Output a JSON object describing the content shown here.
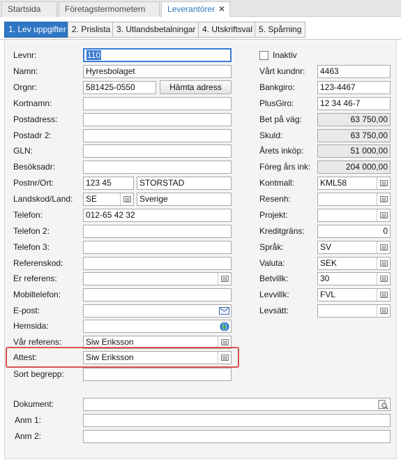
{
  "tabs": {
    "startsida": "Startsida",
    "foretag": "Företagstermometern",
    "leverantorer": "Leverantörer",
    "close": "✕"
  },
  "steps": [
    "1. Lev uppgifter",
    "2. Prislista",
    "3. Utlandsbetalningar",
    "4. Utskriftsval",
    "5. Spårning"
  ],
  "left": {
    "levnr_label": "Levnr:",
    "levnr_value": "110",
    "namn_label": "Namn:",
    "namn_value": "Hyresbolaget",
    "orgnr_label": "Orgnr:",
    "orgnr_value": "581425-0550",
    "hamta_button": "Hämta adress",
    "kortnamn_label": "Kortnamn:",
    "postadress_label": "Postadress:",
    "postadr2_label": "Postadr 2:",
    "gln_label": "GLN:",
    "besoksadr_label": "Besöksadr:",
    "postnr_label": "Postnr/Ort:",
    "postnr_value": "123 45",
    "ort_value": "STORSTAD",
    "landskod_label": "Landskod/Land:",
    "landskod_value": "SE",
    "land_value": "Sverige",
    "telefon_label": "Telefon:",
    "telefon_value": "012-65 42 32",
    "telefon2_label": "Telefon 2:",
    "telefon3_label": "Telefon 3:",
    "referenskod_label": "Referenskod:",
    "erreferens_label": "Er referens:",
    "mobil_label": "Mobiltelefon:",
    "epost_label": "E-post:",
    "hemsida_label": "Hemsida:",
    "varreferens_label": "Vår referens:",
    "varreferens_value": "Siw Eriksson",
    "attest_label": "Attest:",
    "attest_value": "Siw Eriksson",
    "sortbegrepp_label": "Sort begrepp:",
    "dokument_label": "Dokument:",
    "anm1_label": "Anm 1:",
    "anm2_label": "Anm 2:"
  },
  "right": {
    "inaktiv_label": "Inaktiv",
    "kundnr_label": "Vårt kundnr:",
    "kundnr_value": "4463",
    "bankgiro_label": "Bankgiro:",
    "bankgiro_value": "123-4467",
    "plusgiro_label": "PlusGiro:",
    "plusgiro_value": "12 34 46-7",
    "betpavag_label": "Bet på väg:",
    "betpavag_value": "63 750,00",
    "skuld_label": "Skuld:",
    "skuld_value": "63 750,00",
    "aretsinkop_label": "Årets inköp:",
    "aretsinkop_value": "51 000,00",
    "foreg_label": "Föreg års ink:",
    "foreg_value": "204 000,00",
    "kontmall_label": "Kontmall:",
    "kontmall_value": "KML58",
    "resenh_label": "Resenh:",
    "projekt_label": "Projekt:",
    "kreditgrans_label": "Kreditgräns:",
    "kreditgrans_value": "0",
    "sprak_label": "Språk:",
    "sprak_value": "SV",
    "valuta_label": "Valuta:",
    "valuta_value": "SEK",
    "betvillk_label": "Betvillk:",
    "betvillk_value": "30",
    "levvillk_label": "Levvillk:",
    "levvillk_value": "FVL",
    "levsatt_label": "Levsätt:"
  },
  "icons": {
    "lookup": "lookup-list-icon",
    "email": "envelope-icon",
    "web": "globe-icon",
    "document": "document-search-icon"
  },
  "colors": {
    "accent": "#2f77c4",
    "highlight_border": "#d9534f",
    "readonly_bg": "#e9e9e9"
  }
}
